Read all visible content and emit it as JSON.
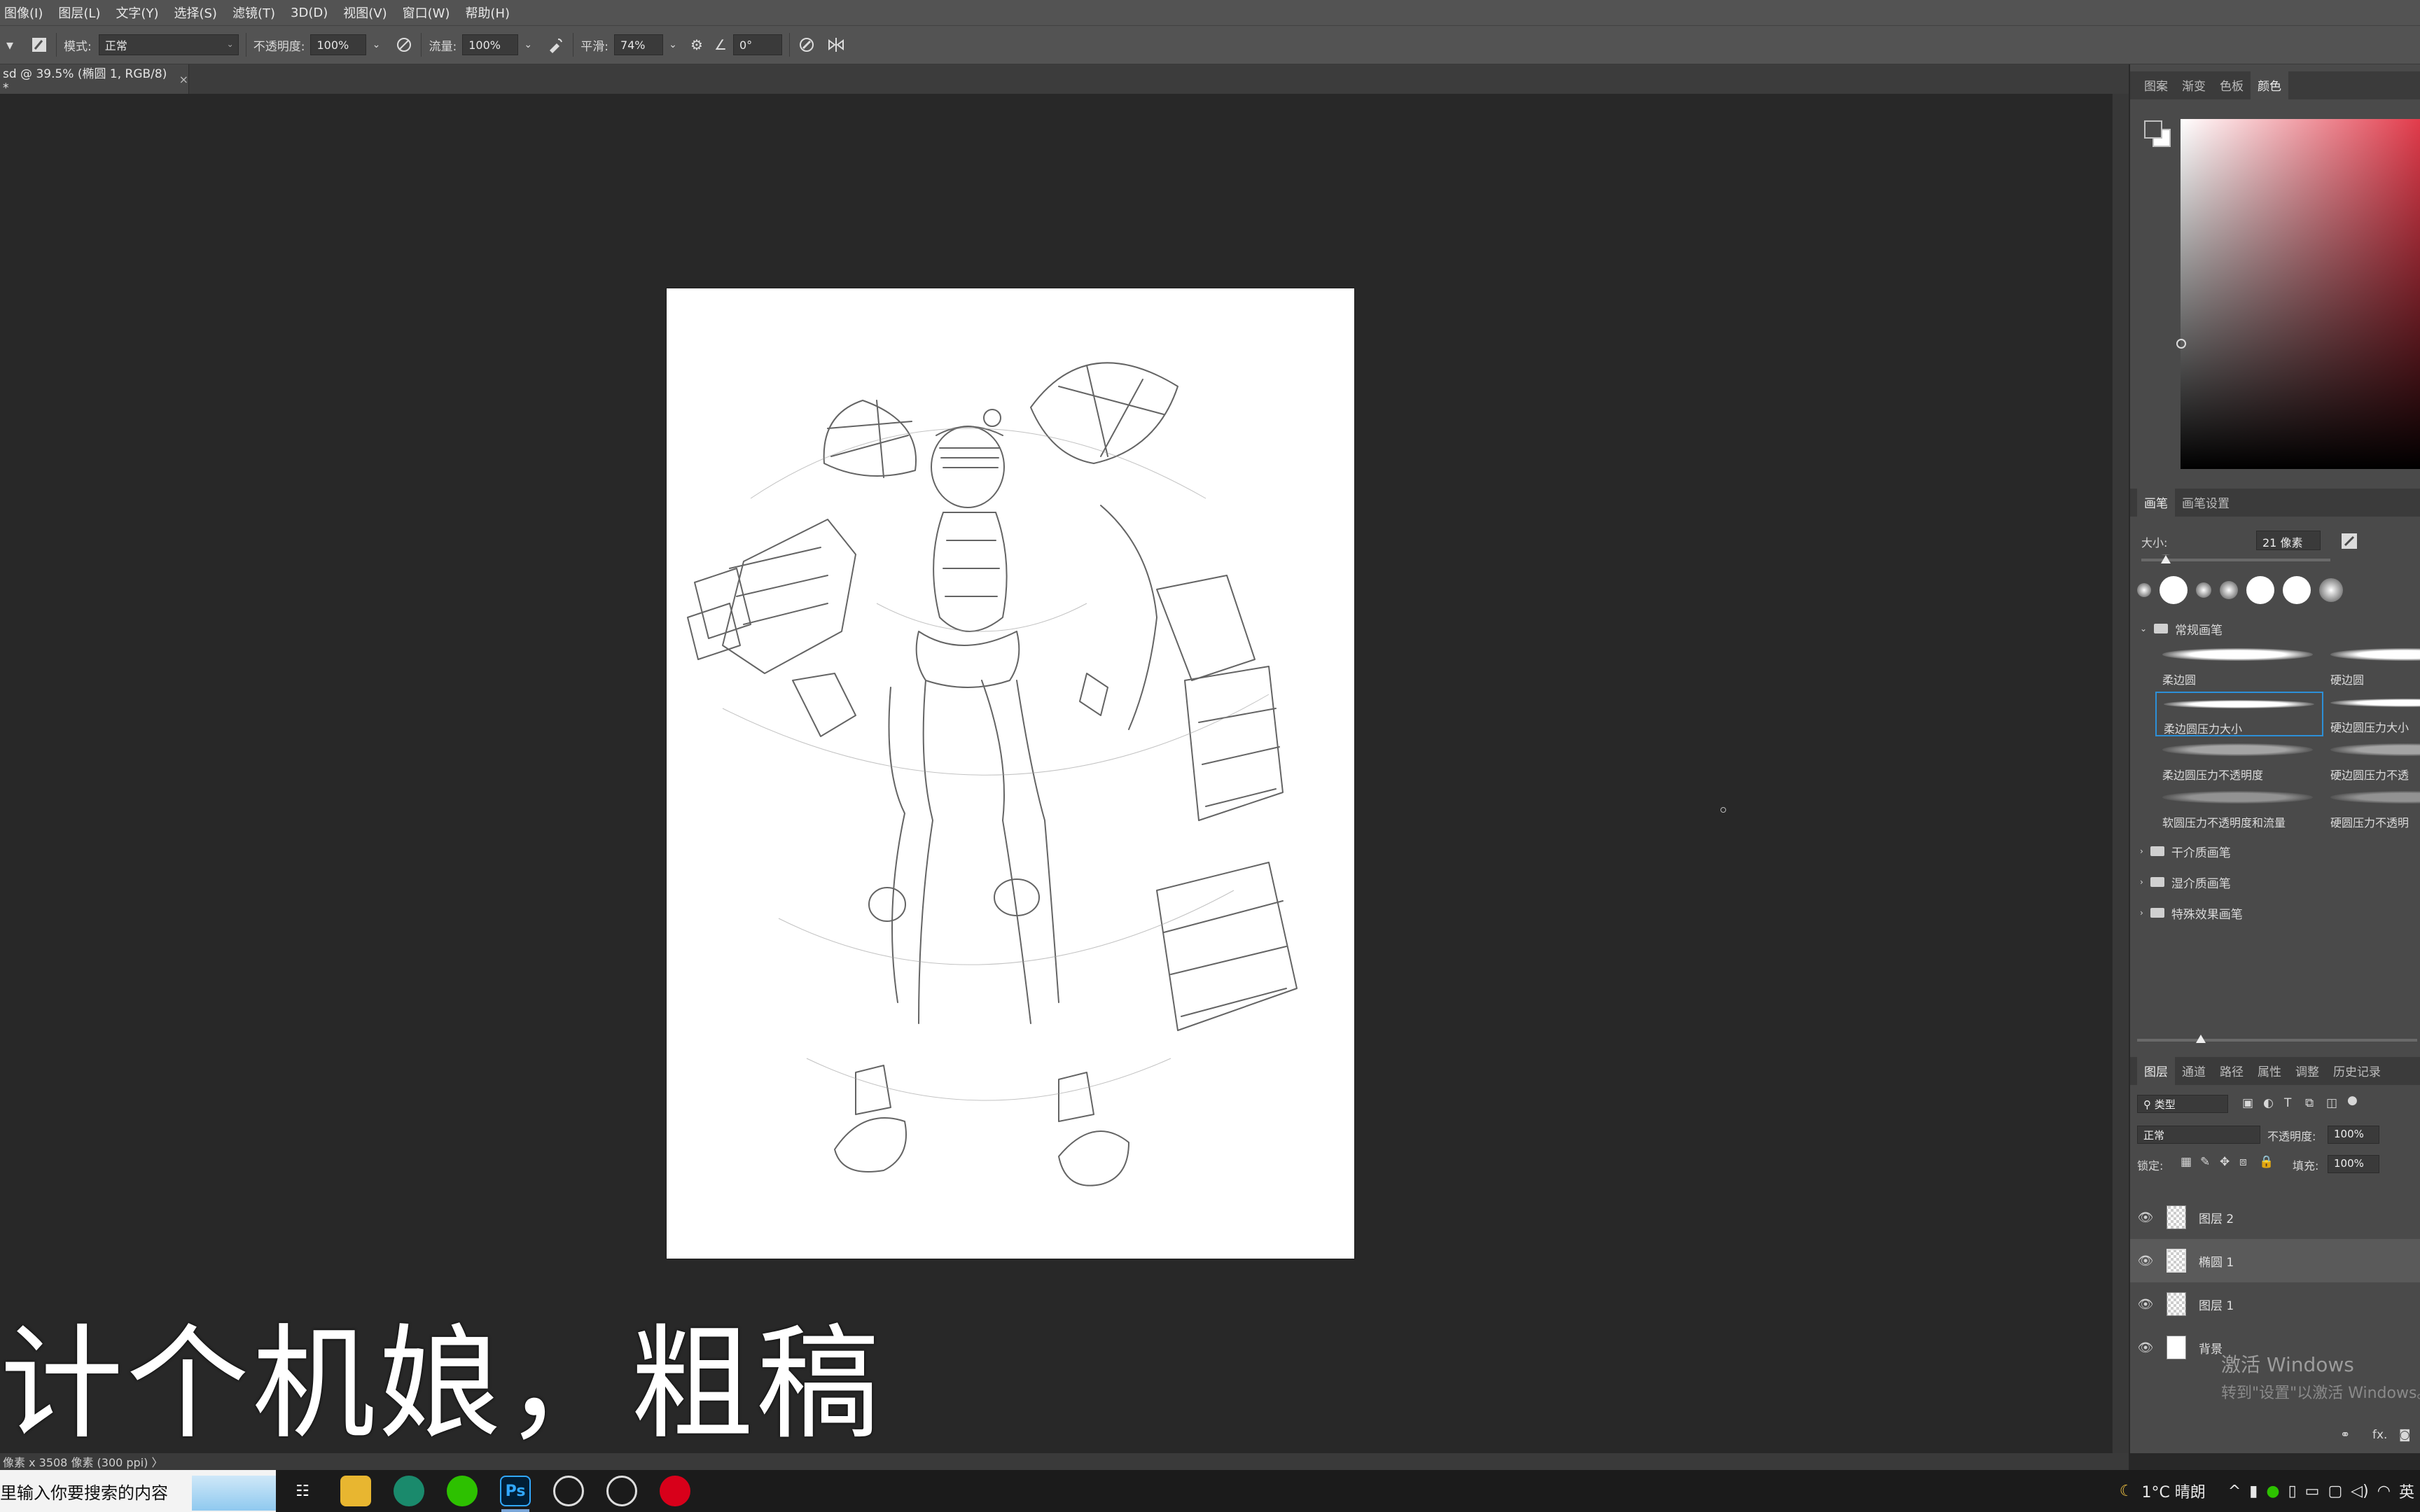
{
  "menu": [
    "图像(I)",
    "图层(L)",
    "文字(Y)",
    "选择(S)",
    "滤镜(T)",
    "3D(D)",
    "视图(V)",
    "窗口(W)",
    "帮助(H)"
  ],
  "options": {
    "mode_label": "模式:",
    "mode_value": "正常",
    "opacity_label": "不透明度:",
    "opacity_value": "100%",
    "flow_label": "流量:",
    "flow_value": "100%",
    "smooth_label": "平滑:",
    "smooth_value": "74%",
    "angle_value": "0°"
  },
  "document_tab": {
    "title": "sd @ 39.5% (椭圆 1, RGB/8) *",
    "close": "×"
  },
  "subtitle": "计个机娘，粗稿",
  "statusbar": "像素 x 3508 像素 (300 ppi)  〉",
  "color_panel": {
    "tabs": [
      "图案",
      "渐变",
      "色板",
      "颜色"
    ],
    "active_tab": "颜色"
  },
  "brush_panel": {
    "tabs": [
      "画笔",
      "画笔设置"
    ],
    "size_label": "大小:",
    "size_value": "21 像素",
    "group_open": "常规画笔",
    "presets": [
      {
        "label": "柔边圆"
      },
      {
        "label": "硬边圆"
      },
      {
        "label": "柔边圆压力大小"
      },
      {
        "label": "硬边圆压力大小"
      },
      {
        "label": "柔边圆压力不透明度"
      },
      {
        "label": "硬边圆压力不透"
      },
      {
        "label": "软圆压力不透明度和流量"
      },
      {
        "label": "硬圆压力不透明"
      }
    ],
    "selected_preset": "柔边圆压力大小",
    "groups_closed": [
      "干介质画笔",
      "湿介质画笔",
      "特殊效果画笔"
    ]
  },
  "layers_panel": {
    "tabs": [
      "图层",
      "通道",
      "路径",
      "属性",
      "调整",
      "历史记录"
    ],
    "filter_label": "类型",
    "blend_mode": "正常",
    "opacity_label": "不透明度:",
    "opacity_value": "100%",
    "lock_label": "锁定:",
    "fill_label": "填充:",
    "fill_value": "100%",
    "layers": [
      {
        "name": "图层 2"
      },
      {
        "name": "椭圆 1"
      },
      {
        "name": "图层 1"
      },
      {
        "name": "背景"
      }
    ],
    "selected_layer": "椭圆 1",
    "footer_icons": [
      "link-icon",
      "fx-icon",
      "mask-icon"
    ],
    "footer_fx": "fx."
  },
  "activation": {
    "line1": "激活 Windows",
    "line2": "转到\"设置\"以激活 Windows。"
  },
  "taskbar": {
    "search_placeholder": "里输入你要搜索的内容",
    "apps": [
      "task-view-icon",
      "file-explorer-icon",
      "edge-icon",
      "wechat-icon",
      "photoshop-icon",
      "app-icon",
      "obs-icon",
      "netease-music-icon"
    ],
    "photoshop_label": "Ps",
    "weather": "1°C 晴朗",
    "ime": "英"
  }
}
